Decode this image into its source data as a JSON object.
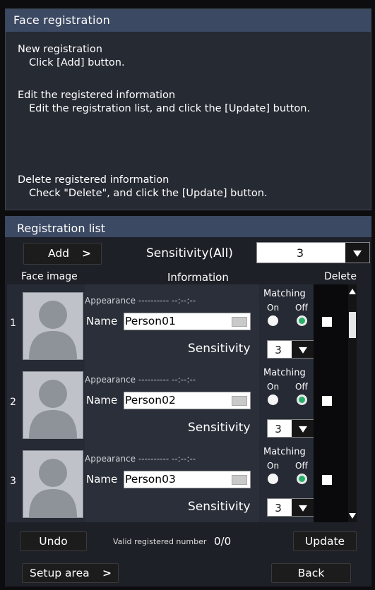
{
  "help": {
    "title": "Face registration",
    "new_heading": "New registration",
    "new_text": "Click [Add] button.",
    "edit_heading": "Edit the registered information",
    "edit_text": "Edit the registration list, and click the [Update] button.",
    "delete_heading": "Delete registered information",
    "delete_text": "Check \"Delete\", and click the [Update] button."
  },
  "registration": {
    "title": "Registration list",
    "add_label": "Add",
    "add_arrow": ">",
    "sensitivity_all_label": "Sensitivity(All)",
    "sensitivity_all_value": "3",
    "columns": {
      "face_image": "Face image",
      "information": "Information",
      "delete": "Delete"
    },
    "rows": [
      {
        "number": "1",
        "appearance": "Appearance ---------- --:--:--",
        "name_label": "Name",
        "name_value": "Person01",
        "matching_label": "Matching",
        "on_label": "On",
        "off_label": "Off",
        "matching_selected": "Off",
        "sensitivity_label": "Sensitivity",
        "sensitivity_value": "3",
        "delete_checked": false
      },
      {
        "number": "2",
        "appearance": "Appearance ---------- --:--:--",
        "name_label": "Name",
        "name_value": "Person02",
        "matching_label": "Matching",
        "on_label": "On",
        "off_label": "Off",
        "matching_selected": "Off",
        "sensitivity_label": "Sensitivity",
        "sensitivity_value": "3",
        "delete_checked": false
      },
      {
        "number": "3",
        "appearance": "Appearance ---------- --:--:--",
        "name_label": "Name",
        "name_value": "Person03",
        "matching_label": "Matching",
        "on_label": "On",
        "off_label": "Off",
        "matching_selected": "Off",
        "sensitivity_label": "Sensitivity",
        "sensitivity_value": "3",
        "delete_checked": false
      }
    ],
    "undo_label": "Undo",
    "valid_label": "Valid registered number",
    "valid_value": "0/0",
    "update_label": "Update"
  },
  "footer": {
    "setup_label": "Setup area",
    "setup_arrow": ">",
    "back_label": "Back"
  },
  "colors": {
    "panel_header": "#3c4963",
    "panel_bg": "#262a33",
    "radio_selected": "#25b06a"
  }
}
